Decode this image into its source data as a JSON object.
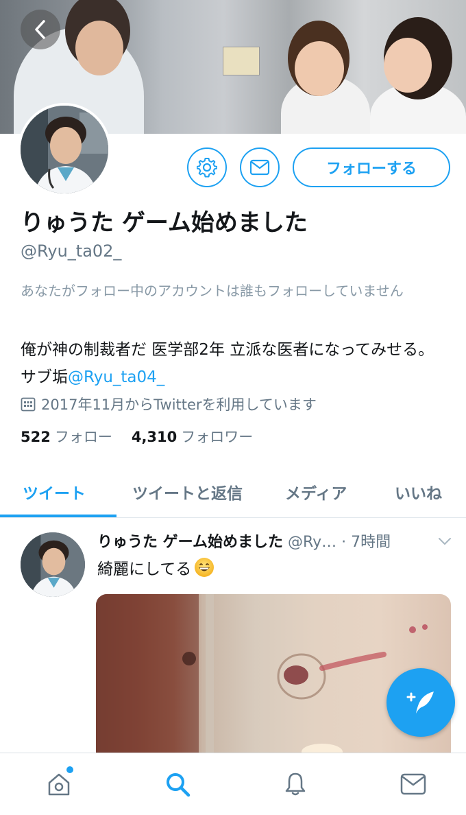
{
  "profile": {
    "display_name": "りゅうた ゲーム始めました",
    "handle": "@Ryu_ta02_",
    "follow_label": "フォローする",
    "follow_notice": "あなたがフォロー中のアカウントは誰もフォローしていません",
    "bio_text": "俺が神の制裁者だ 医学部2年 立派な医者になってみせる。サブ垢",
    "bio_link": "@Ryu_ta04_",
    "joined": "2017年11月からTwitterを利用しています",
    "following_count": "522",
    "following_label": "フォロー",
    "followers_count": "4,310",
    "followers_label": "フォロワー"
  },
  "tabs": [
    {
      "label": "ツイート",
      "active": true
    },
    {
      "label": "ツイートと返信",
      "active": false
    },
    {
      "label": "メディア",
      "active": false
    },
    {
      "label": "いいね",
      "active": false
    }
  ],
  "tweet": {
    "author": "りゅうた ゲーム始めました",
    "handle_time": "@Ry… · 7時間",
    "text": "綺麗にしてる"
  },
  "icons": {
    "back": "chevron-left-icon",
    "settings": "gear-icon",
    "message": "envelope-icon",
    "compose": "compose-tweet-icon",
    "home": "home-icon",
    "search": "search-icon",
    "notifications": "bell-icon",
    "messages": "envelope-icon"
  },
  "colors": {
    "accent": "#1da1f2",
    "text": "#14171a",
    "muted": "#657786"
  }
}
